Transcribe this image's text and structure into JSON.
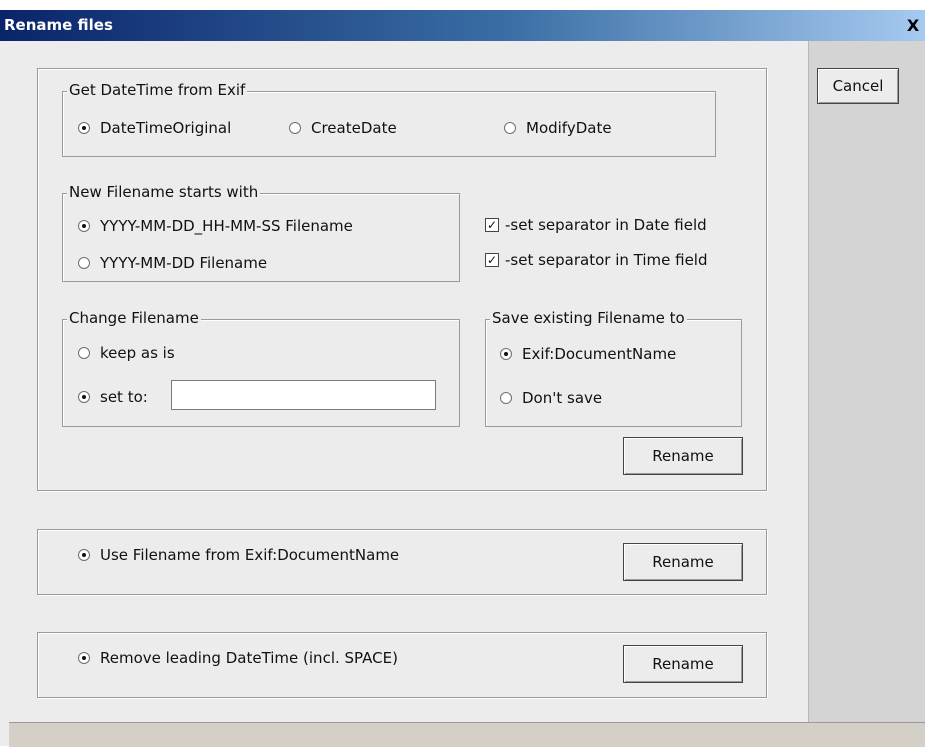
{
  "window": {
    "title": "Rename files",
    "close_glyph": "X"
  },
  "sidebar": {
    "cancel_label": "Cancel"
  },
  "datetime_group": {
    "legend": "Get DateTime from Exif",
    "options": [
      "DateTimeOriginal",
      "CreateDate",
      "ModifyDate"
    ],
    "selected": "DateTimeOriginal"
  },
  "filename_start_group": {
    "legend": "New Filename starts with",
    "options": [
      "YYYY-MM-DD_HH-MM-SS Filename",
      "YYYY-MM-DD Filename"
    ],
    "selected": "YYYY-MM-DD_HH-MM-SS Filename"
  },
  "separators": {
    "date_label": "-set separator in Date field",
    "date_checked": true,
    "time_label": "-set separator in Time field",
    "time_checked": true
  },
  "change_filename_group": {
    "legend": "Change Filename",
    "keep_label": "keep as is",
    "set_label": "set to:",
    "set_value": "",
    "selected": "set to:"
  },
  "save_existing_group": {
    "legend": "Save existing Filename to",
    "options": [
      "Exif:DocumentName",
      "Don't save"
    ],
    "selected": "Exif:DocumentName"
  },
  "rename_label": "Rename",
  "section2": {
    "option_label": "Use Filename from Exif:DocumentName",
    "selected": true
  },
  "section3": {
    "option_label": "Remove leading DateTime (incl. SPACE)",
    "selected": true
  }
}
